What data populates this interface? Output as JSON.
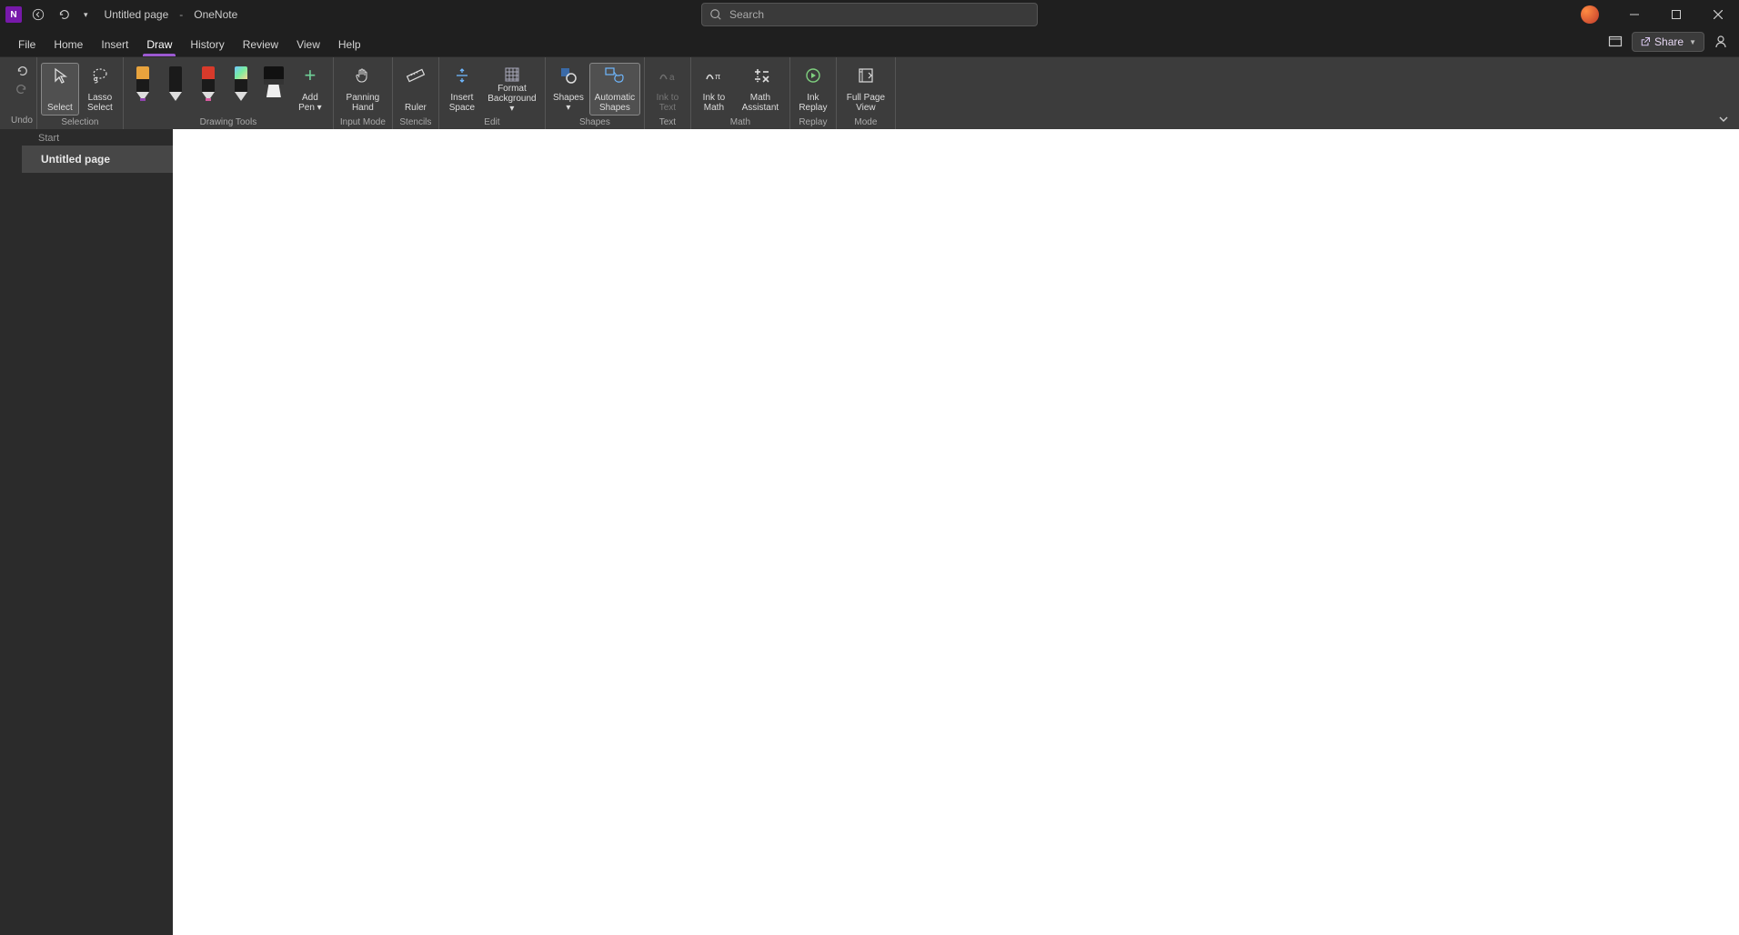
{
  "titlebar": {
    "doc_title": "Untitled page",
    "separator": "-",
    "app_name": "OneNote",
    "search_placeholder": "Search"
  },
  "menu": {
    "tabs": [
      "File",
      "Home",
      "Insert",
      "Draw",
      "History",
      "Review",
      "View",
      "Help"
    ],
    "active_index": 3,
    "share_label": "Share"
  },
  "ribbon": {
    "groups": {
      "undo": {
        "label": "Undo"
      },
      "selection": {
        "label": "Selection",
        "select": "Select",
        "lasso": "Lasso Select"
      },
      "tools": {
        "label": "Drawing Tools",
        "add_pen_line1": "Add",
        "add_pen_line2": "Pen ▾"
      },
      "input": {
        "label": "Input Mode",
        "panning_line1": "Panning",
        "panning_line2": "Hand"
      },
      "stencils": {
        "label": "Stencils",
        "ruler": "Ruler"
      },
      "edit": {
        "label": "Edit",
        "space_line1": "Insert",
        "space_line2": "Space",
        "format_line1": "Format",
        "format_line2": "Background ▾"
      },
      "shapes": {
        "label": "Shapes",
        "shapes_line1": "Shapes",
        "shapes_dd": "▾",
        "auto_line1": "Automatic",
        "auto_line2": "Shapes"
      },
      "text": {
        "label": "Text",
        "ink_text_line1": "Ink to",
        "ink_text_line2": "Text"
      },
      "math": {
        "label": "Math",
        "ink_math_line1": "Ink to",
        "ink_math_line2": "Math",
        "assist_line1": "Math",
        "assist_line2": "Assistant"
      },
      "replay": {
        "label": "Replay",
        "ink_replay_line1": "Ink",
        "ink_replay_line2": "Replay"
      },
      "mode": {
        "label": "Mode",
        "full_line1": "Full Page",
        "full_line2": "View"
      }
    },
    "pens": [
      {
        "name": "pen-orange-purple",
        "top": "#e8a33d",
        "tip_accent": "#8e44ad"
      },
      {
        "name": "pen-black",
        "top": "#1a1a1a",
        "tip_accent": "#dddddd"
      },
      {
        "name": "pen-red",
        "top": "#d83a2b",
        "tip_accent": "#d85aa0"
      },
      {
        "name": "pen-rainbow",
        "top": "linear-gradient(135deg,#6fc6ff,#7bed9f,#f7d794)",
        "tip_accent": "#dddddd"
      }
    ]
  },
  "pagelist": {
    "section_label": "Start",
    "items": [
      "Untitled page"
    ],
    "selected_index": 0
  },
  "colors": {
    "accent": "#9b59d0",
    "bg_dark": "#1f1f1f",
    "ribbon_bg": "#3c3c3c",
    "canvas": "#ffffff"
  }
}
